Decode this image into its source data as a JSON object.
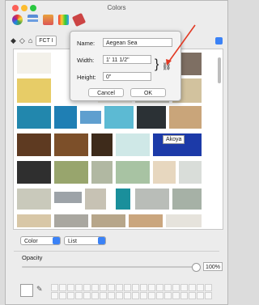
{
  "window": {
    "title": "Colors"
  },
  "colors": {
    "traffic_close": "#fc5f57",
    "traffic_minimize": "#fdbc2e",
    "traffic_zoom": "#2ac840",
    "accent": "#3b82f6",
    "annotation_arrow": "#e23a24"
  },
  "toolbar": [
    {
      "name": "color-wheel-icon",
      "color": "#e05a5a"
    },
    {
      "name": "sliders-icon",
      "color": "#4a7bd1"
    },
    {
      "name": "palettes-icon",
      "color": "#3aa0c9"
    },
    {
      "name": "pencils-icon",
      "color": "#c59a3b"
    },
    {
      "name": "images-icon",
      "color": "#b63d3d"
    }
  ],
  "path": {
    "label": "FCT I"
  },
  "popover": {
    "name_label": "Name:",
    "name_value": "Aegean Sea",
    "width_label": "Width:",
    "width_value": "1' 11 1/2\"",
    "height_label": "Height:",
    "height_value": "0\"",
    "cancel_label": "Cancel",
    "ok_label": "OK"
  },
  "tooltip": {
    "text": "Akoya"
  },
  "bottom": {
    "mode_select": "Color",
    "view_select": "List",
    "opacity_label": "Opacity",
    "opacity_value": "100%"
  }
}
